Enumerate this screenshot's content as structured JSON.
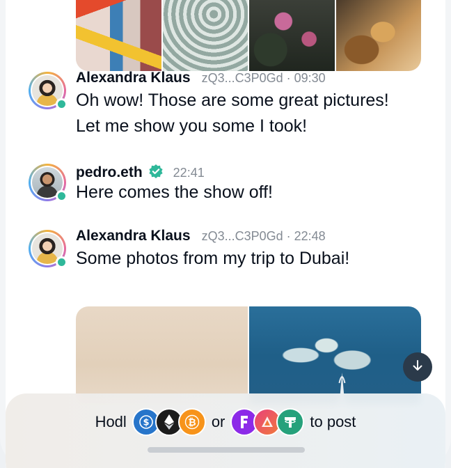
{
  "messages": [
    {
      "author": "Alexandra Klaus",
      "address": "zQ3...C3P0Gd",
      "time": "09:30",
      "text_lines": [
        "Oh wow! Those are some great pictures!",
        "Let me show you some I took!"
      ]
    },
    {
      "author": "pedro.eth",
      "verified": true,
      "time": "22:41",
      "text_lines": [
        "Here comes the show off!"
      ]
    },
    {
      "author": "Alexandra Klaus",
      "address": "zQ3...C3P0Gd",
      "time": "22:48",
      "text_lines": [
        "Some photos from my trip to Dubai!"
      ]
    }
  ],
  "composer": {
    "prefix": "Hodl",
    "middle": "or",
    "suffix": "to post",
    "tokens_group_1": [
      "usdc-icon",
      "ethereum-icon",
      "bitcoin-icon"
    ],
    "tokens_group_2": [
      "fantom-icon",
      "apecoin-icon",
      "tether-icon"
    ]
  },
  "colors": {
    "online": "#2fb89a",
    "verified": "#2fb89a",
    "text": "#09101c",
    "muted": "#838a93"
  },
  "icons": {
    "scroll_down": "arrow-down-icon"
  }
}
